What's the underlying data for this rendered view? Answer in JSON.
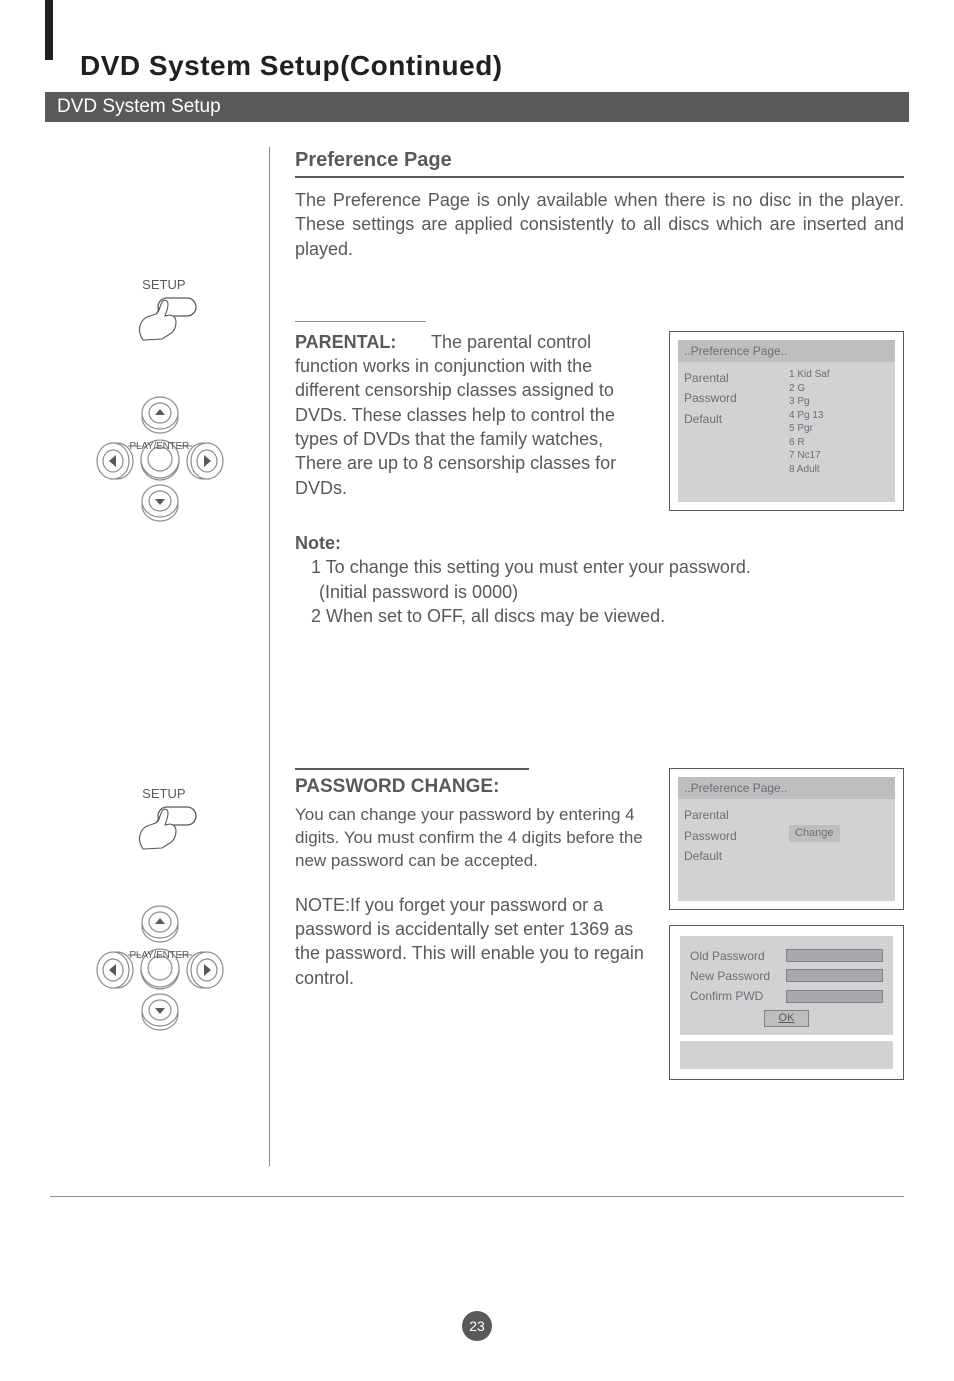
{
  "chapter_title": "DVD System Setup(Continued)",
  "section_bar": "DVD System Setup",
  "left": {
    "setup_label": "SETUP",
    "play_enter_label": "PLAY/ENTER"
  },
  "preference": {
    "heading": "Preference Page",
    "intro": "The Preference Page is only available when there is no disc in the player. These settings are applied consistently to all discs which are inserted and played."
  },
  "parental": {
    "label": "PARENTAL:",
    "text": "  The parental control function works in conjunction   with   the different  censorship  classes assigned to DVDs. These classes help to control the types of DVDs that the family watches, There are up to 8 censorship classes for DVDs."
  },
  "osd1": {
    "title": "..Preference Page..",
    "menu": [
      "Parental",
      "Password",
      "Default"
    ],
    "ratings": [
      "1 Kid Saf",
      "2 G",
      "3 Pg",
      "4 Pg 13",
      "5 Pgr",
      "6 R",
      "7 Nc17",
      "8 Adult"
    ]
  },
  "note": {
    "heading": "Note:",
    "line1": "1 To change this setting you must enter your password.",
    "line1b": "(Initial password is 0000)",
    "line2": "2 When set to OFF, all discs may be viewed."
  },
  "password": {
    "heading": "PASSWORD CHANGE:",
    "text": "You can change your password by entering 4 digits. You must confirm the 4 digits before the new password can be accepted.",
    "note": "NOTE:If you forget your password or a password is accidentally set enter 1369 as the password. This will enable you to regain control."
  },
  "osd2": {
    "title": "..Preference Page..",
    "menu": [
      "Parental",
      "Password",
      "Default"
    ],
    "change": "Change"
  },
  "pwdform": {
    "old": "Old Password",
    "new": "New Password",
    "confirm": "Confirm PWD",
    "ok": "OK"
  },
  "page_number": "23"
}
